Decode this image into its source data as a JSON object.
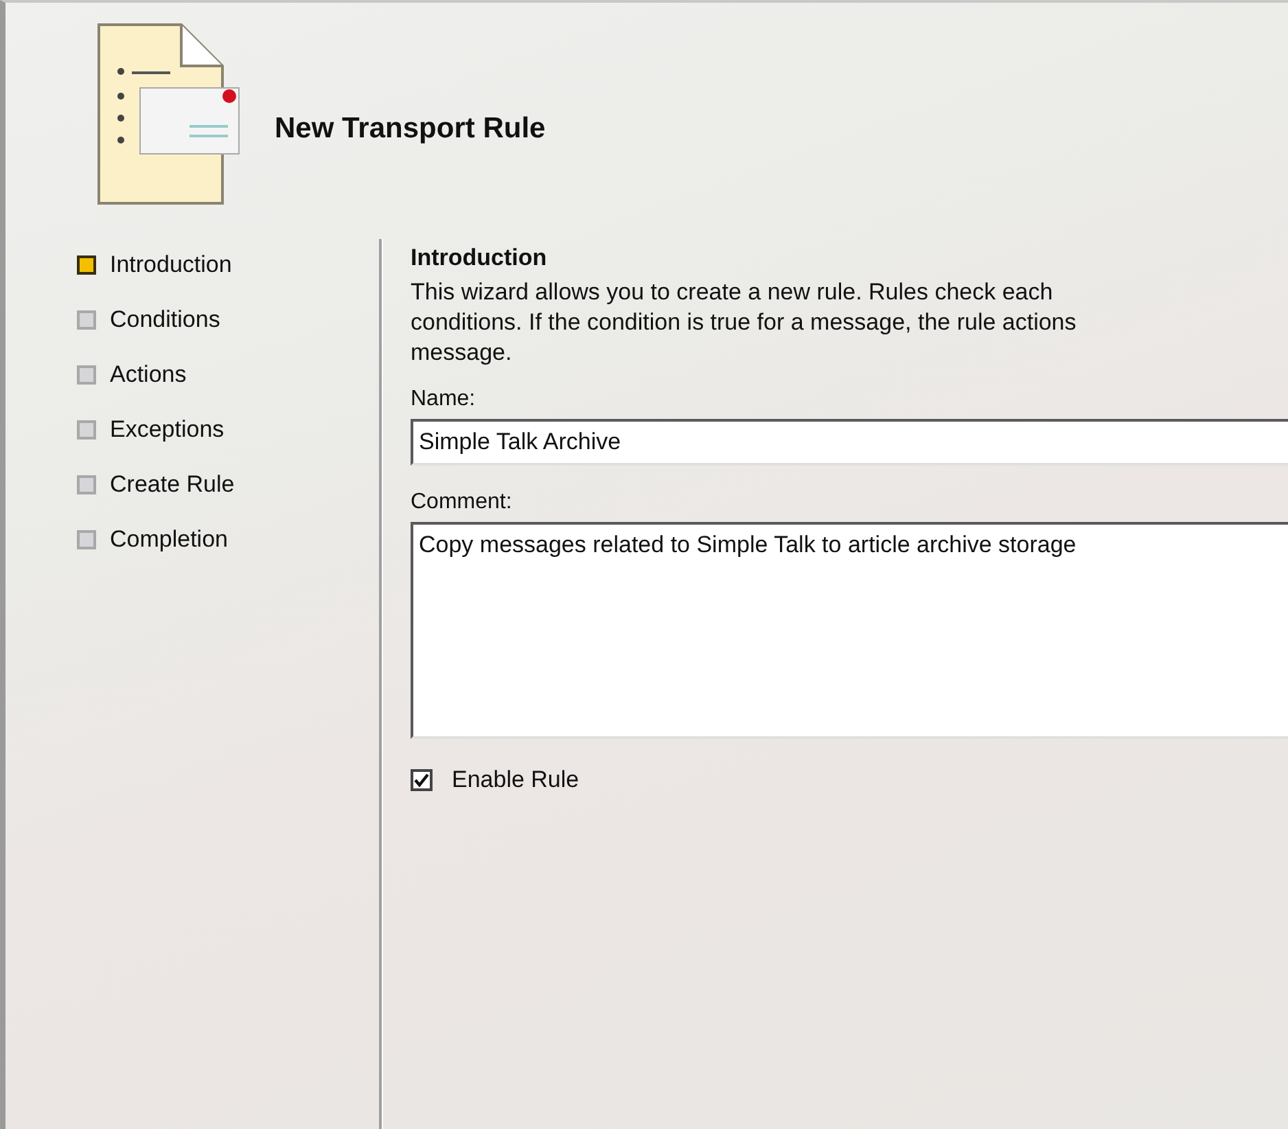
{
  "header": {
    "title": "New Transport Rule"
  },
  "steps": [
    {
      "label": "Introduction",
      "selected": true
    },
    {
      "label": "Conditions",
      "selected": false
    },
    {
      "label": "Actions",
      "selected": false
    },
    {
      "label": "Exceptions",
      "selected": false
    },
    {
      "label": "Create Rule",
      "selected": false
    },
    {
      "label": "Completion",
      "selected": false
    }
  ],
  "page": {
    "heading": "Introduction",
    "description_lines": [
      "This wizard allows you to create a new rule. Rules check each",
      "conditions. If the condition is true for a message, the rule actions",
      "message."
    ],
    "name_label": "Name:",
    "name_value": "Simple Talk Archive",
    "comment_label": "Comment:",
    "comment_value": "Copy messages related to Simple Talk to article archive storage",
    "enable": {
      "label": "Enable Rule",
      "checked": true
    }
  }
}
